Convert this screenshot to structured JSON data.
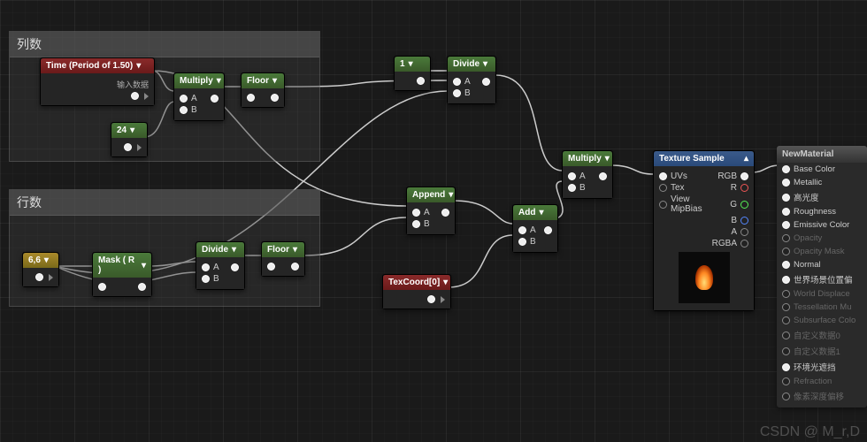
{
  "groups": {
    "cols": {
      "title": "列数"
    },
    "rows": {
      "title": "行数"
    }
  },
  "nodes": {
    "time": {
      "title": "Time (Period of 1.50)",
      "sub": "输入数据"
    },
    "const24": {
      "label": "24"
    },
    "multiply1": {
      "title": "Multiply",
      "inA": "A",
      "inB": "B"
    },
    "floor1": {
      "title": "Floor"
    },
    "const66": {
      "label": "6,6"
    },
    "mask": {
      "title": "Mask ( R )"
    },
    "divide1": {
      "title": "Divide",
      "inA": "A",
      "inB": "B"
    },
    "floor2": {
      "title": "Floor"
    },
    "const1": {
      "label": "1"
    },
    "divide2": {
      "title": "Divide",
      "inA": "A",
      "inB": "B"
    },
    "append": {
      "title": "Append",
      "inA": "A",
      "inB": "B"
    },
    "texcoord": {
      "title": "TexCoord[0]"
    },
    "add": {
      "title": "Add",
      "inA": "A",
      "inB": "B"
    },
    "multiply2": {
      "title": "Multiply",
      "inA": "A",
      "inB": "B"
    },
    "texsample": {
      "title": "Texture Sample",
      "inUVs": "UVs",
      "inTex": "Tex",
      "inMip": "View MipBias",
      "outRGB": "RGB",
      "outR": "R",
      "outG": "G",
      "outB": "B",
      "outA": "A",
      "outRGBA": "RGBA"
    }
  },
  "material": {
    "title": "NewMaterial",
    "pins": [
      {
        "label": "Base Color",
        "active": true
      },
      {
        "label": "Metallic",
        "active": true
      },
      {
        "label": "高光度",
        "active": true
      },
      {
        "label": "Roughness",
        "active": true
      },
      {
        "label": "Emissive Color",
        "active": true
      },
      {
        "label": "Opacity",
        "active": false
      },
      {
        "label": "Opacity Mask",
        "active": false
      },
      {
        "label": "Normal",
        "active": true
      },
      {
        "label": "世界场景位置偏",
        "active": true
      },
      {
        "label": "World Displace",
        "active": false
      },
      {
        "label": "Tessellation Mu",
        "active": false
      },
      {
        "label": "Subsurface Colo",
        "active": false
      },
      {
        "label": "自定义数据0",
        "active": false
      },
      {
        "label": "自定义数据1",
        "active": false
      },
      {
        "label": "环境光遮挡",
        "active": true
      },
      {
        "label": "Refraction",
        "active": false
      },
      {
        "label": "像素深度偏移",
        "active": false
      }
    ]
  },
  "watermark": "CSDN @ M_r,D"
}
